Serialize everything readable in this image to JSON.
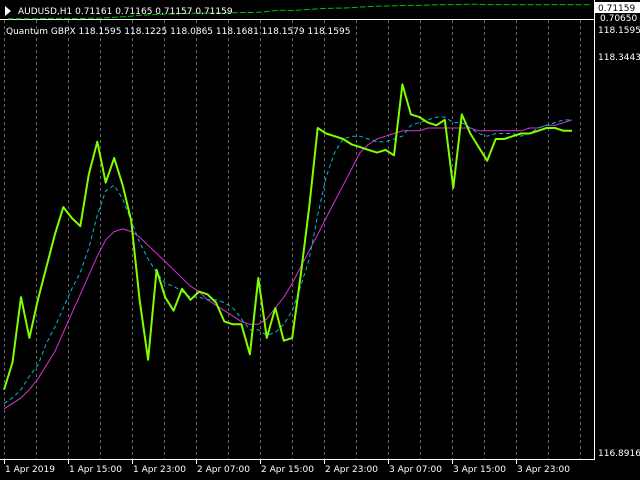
{
  "header": {
    "main_title": "AUDUSD,H1  0.71161 0.71165 0.71157 0.71159",
    "sub_title": "Quantum GBPX 118.1595 118.1225 118.0865 118.1681 118.1579 118.1595"
  },
  "colors": {
    "background": "#000000",
    "main_line": "#00c000",
    "quantum": "#7fff00",
    "fast_ma": "#00bcd4",
    "slow_ma": "#d633d6",
    "grid": "#c0c0c0",
    "price_box": "#ffffff"
  },
  "chart_data": [
    {
      "type": "line",
      "title": "AUDUSD,H1",
      "ylim": [
        0.7065,
        0.7118
      ],
      "price_labels": [
        "0.71159",
        "0.70650"
      ],
      "series": [
        {
          "values": [
            0.7066,
            0.7066,
            0.7066,
            0.7066,
            0.7067,
            0.7067,
            0.7067,
            0.7066,
            0.7068,
            0.7068,
            0.707,
            0.7072,
            0.7075,
            0.7078,
            0.708,
            0.7082,
            0.7083,
            0.7084,
            0.7085,
            0.7086,
            0.7086,
            0.7087,
            0.7087,
            0.7088,
            0.7088,
            0.709,
            0.7094,
            0.7096,
            0.7095,
            0.7098,
            0.71,
            0.7102,
            0.7103,
            0.7104,
            0.7106,
            0.7108,
            0.711,
            0.7111,
            0.7112,
            0.7113,
            0.7113,
            0.7114,
            0.7115,
            0.7116,
            0.7116,
            0.7117,
            0.7117,
            0.7116,
            0.7116,
            0.7116,
            0.7115,
            0.7116,
            0.7115,
            0.7116,
            0.7116,
            0.7116,
            0.7115,
            0.7116
          ]
        }
      ]
    },
    {
      "type": "line",
      "title": "Quantum GBPX",
      "ylim": [
        116.8916,
        118.3443
      ],
      "y_labels": [
        "118.1595",
        "118.3443",
        "116.8916"
      ],
      "x_tick_labels": [
        "1 Apr 2019",
        "1 Apr 15:00",
        "1 Apr 23:00",
        "2 Apr 07:00",
        "2 Apr 15:00",
        "2 Apr 23:00",
        "3 Apr 07:00",
        "3 Apr 15:00",
        "3 Apr 23:00"
      ],
      "series": [
        {
          "values": [
            117.12,
            117.22,
            117.46,
            117.31,
            117.45,
            117.57,
            117.69,
            117.79,
            117.75,
            117.72,
            117.91,
            118.03,
            117.88,
            117.97,
            117.87,
            117.74,
            117.45,
            117.23,
            117.56,
            117.46,
            117.41,
            117.49,
            117.45,
            117.48,
            117.47,
            117.44,
            117.37,
            117.36,
            117.36,
            117.25,
            117.53,
            117.31,
            117.42,
            117.3,
            117.31,
            117.54,
            117.79,
            118.08,
            118.06,
            118.05,
            118.04,
            118.02,
            118.01,
            118.0,
            117.99,
            118.0,
            117.98,
            118.24,
            118.13,
            118.12,
            118.1,
            118.09,
            118.11,
            117.86,
            118.13,
            118.06,
            118.01,
            117.96,
            118.04,
            118.04,
            118.05,
            118.06,
            118.06,
            118.07,
            118.08,
            118.08,
            118.07,
            118.07
          ]
        },
        {
          "values": [
            117.07,
            117.09,
            117.12,
            117.17,
            117.21,
            117.29,
            117.35,
            117.42,
            117.49,
            117.55,
            117.64,
            117.76,
            117.85,
            117.87,
            117.82,
            117.74,
            117.66,
            117.6,
            117.55,
            117.51,
            117.5,
            117.48,
            117.46,
            117.46,
            117.45,
            117.45,
            117.44,
            117.42,
            117.38,
            117.34,
            117.34,
            117.32,
            117.33,
            117.36,
            117.41,
            117.5,
            117.6,
            117.76,
            117.9,
            117.99,
            118.04,
            118.05,
            118.05,
            118.04,
            118.03,
            118.03,
            118.04,
            118.05,
            118.09,
            118.1,
            118.11,
            118.12,
            118.12,
            118.1,
            118.1,
            118.08,
            118.06,
            118.05,
            118.06,
            118.06,
            118.06,
            118.05,
            118.06,
            118.08,
            118.09,
            118.1,
            118.11,
            118.11
          ]
        },
        {
          "values": [
            117.05,
            117.07,
            117.09,
            117.12,
            117.16,
            117.21,
            117.26,
            117.33,
            117.4,
            117.47,
            117.54,
            117.61,
            117.67,
            117.7,
            117.71,
            117.7,
            117.68,
            117.65,
            117.62,
            117.59,
            117.56,
            117.53,
            117.5,
            117.48,
            117.45,
            117.43,
            117.41,
            117.39,
            117.37,
            117.36,
            117.36,
            117.38,
            117.42,
            117.46,
            117.51,
            117.57,
            117.63,
            117.69,
            117.75,
            117.81,
            117.87,
            117.93,
            117.99,
            118.02,
            118.04,
            118.05,
            118.06,
            118.07,
            118.07,
            118.07,
            118.08,
            118.08,
            118.08,
            118.08,
            118.08,
            118.08,
            118.07,
            118.07,
            118.07,
            118.07,
            118.07,
            118.07,
            118.08,
            118.08,
            118.09,
            118.09,
            118.1,
            118.11
          ]
        }
      ]
    }
  ]
}
